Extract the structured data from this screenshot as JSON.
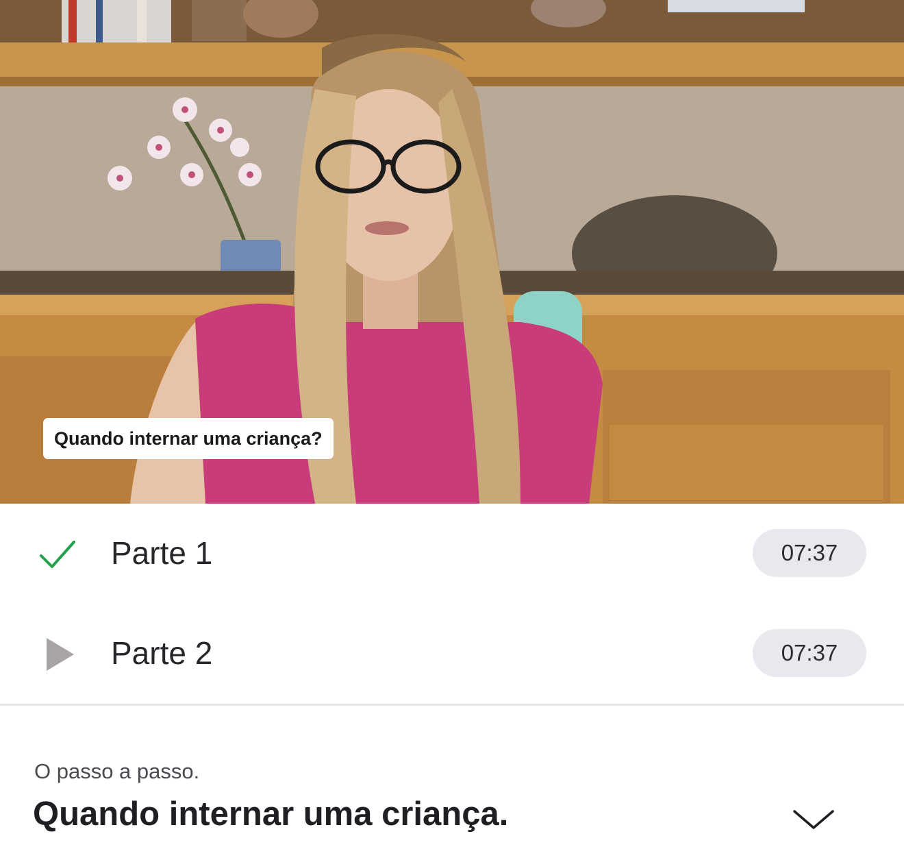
{
  "video": {
    "caption": "Quando internar uma criança?"
  },
  "parts": [
    {
      "label": "Parte 1",
      "duration": "07:37",
      "status_icon": "check-icon",
      "status_color": "#22a04b"
    },
    {
      "label": "Parte 2",
      "duration": "07:37",
      "status_icon": "play-icon",
      "status_color": "#a7a3a6"
    }
  ],
  "lesson": {
    "subtitle": "O passo a passo.",
    "title": "Quando internar uma criança.",
    "expand_icon": "chevron-down-icon"
  }
}
